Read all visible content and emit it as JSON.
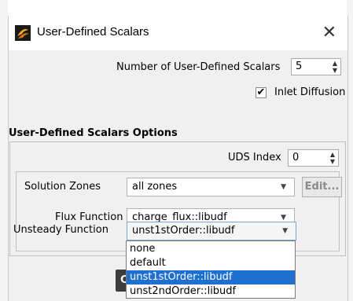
{
  "window": {
    "title": "User-Defined Scalars",
    "close_glyph": "✕",
    "icon": "fluent-app-icon"
  },
  "num_scalars": {
    "label": "Number of User-Defined Scalars",
    "value": "5"
  },
  "inlet_diffusion": {
    "label": "Inlet Diffusion",
    "checked": true,
    "check_glyph": "✔"
  },
  "options": {
    "title": "User-Defined Scalars Options",
    "uds_index_label": "UDS Index",
    "uds_index_value": "0",
    "solution_zones_label": "Solution Zones",
    "solution_zones_value": "all zones",
    "edit_label": "Edit...",
    "flux_function_label": "Flux Function",
    "flux_function_value": "charge_flux::libudf",
    "unsteady_function_label": "Unsteady Function",
    "unsteady_function_value": "unst1stOrder::libudf"
  },
  "dropdown": {
    "items": [
      "none",
      "default",
      "unst1stOrder::libudf",
      "unst2ndOrder::libudf"
    ],
    "selected_index": 2
  },
  "footer": {
    "partial_button_text": "C"
  },
  "colors": {
    "selection": "#1e6fd0",
    "dialog_bg": "#f0f0f0"
  }
}
